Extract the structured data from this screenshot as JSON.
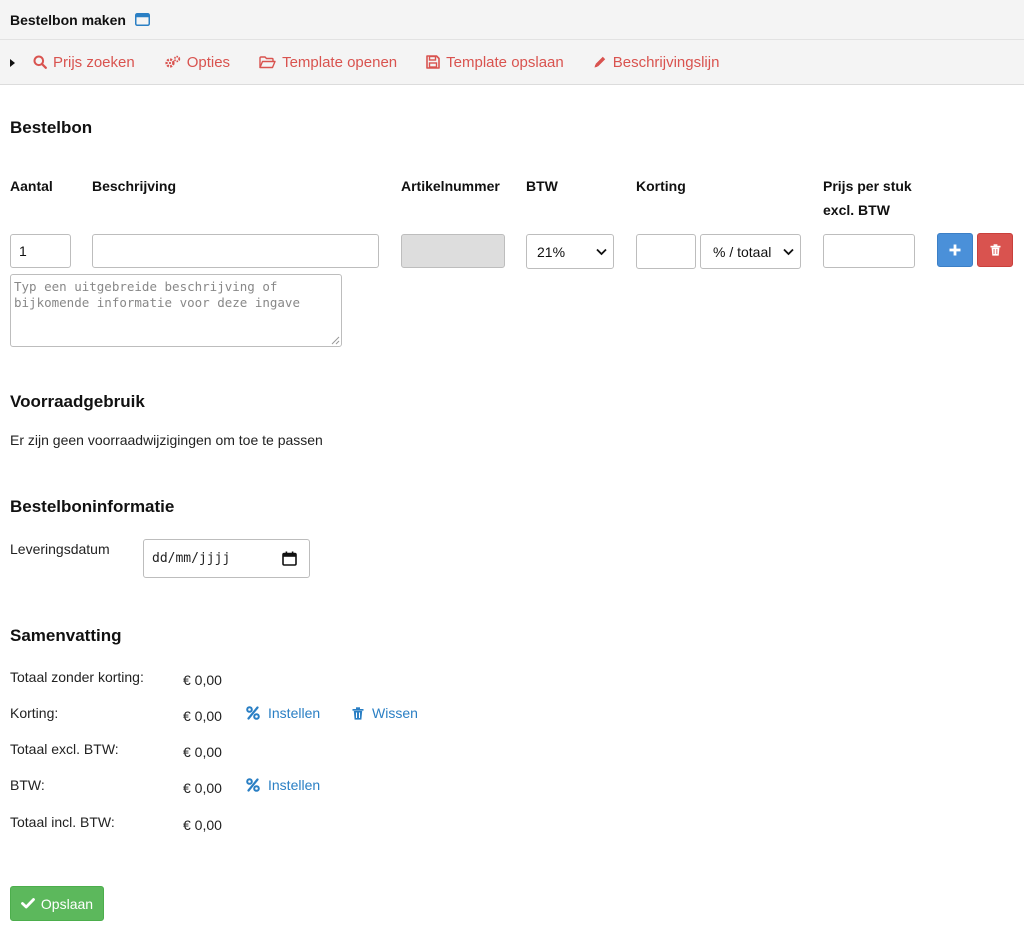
{
  "window": {
    "title": "Bestelbon maken",
    "icon": "window-icon"
  },
  "toolbar": {
    "items": [
      {
        "label": "Prijs zoeken",
        "icon": "search-icon"
      },
      {
        "label": "Opties",
        "icon": "cogs-icon"
      },
      {
        "label": "Template openen",
        "icon": "folder-open-icon"
      },
      {
        "label": "Template opslaan",
        "icon": "floppy-icon"
      },
      {
        "label": "Beschrijvingslijn",
        "icon": "pencil-icon"
      }
    ]
  },
  "bestelbon": {
    "heading": "Bestelbon",
    "columns": {
      "aantal": "Aantal",
      "beschrijving": "Beschrijving",
      "artikelnummer": "Artikelnummer",
      "btw": "BTW",
      "korting": "Korting",
      "prijs_line1": "Prijs per stuk",
      "prijs_line2": "excl. BTW"
    },
    "row": {
      "aantal": "1",
      "beschrijving": "",
      "artikelnummer": "",
      "btw": "21%",
      "korting_value": "",
      "korting_type": "% / totaal",
      "prijs": ""
    },
    "extra_placeholder": "Typ een uitgebreide beschrijving of\nbijkomende informatie voor deze ingave"
  },
  "voorraad": {
    "heading": "Voorraadgebruik",
    "message": "Er zijn geen voorraadwijzigingen om toe te passen"
  },
  "info": {
    "heading": "Bestelboninformatie",
    "levering_label": "Leveringsdatum",
    "levering_placeholder": "dd/mm/jjjj"
  },
  "samenvatting": {
    "heading": "Samenvatting",
    "rows": [
      {
        "label": "Totaal zonder korting:",
        "value": "€ 0,00"
      },
      {
        "label": "Korting:",
        "value": "€ 0,00"
      },
      {
        "label": "Totaal excl. BTW:",
        "value": "€ 0,00"
      },
      {
        "label": "BTW:",
        "value": "€ 0,00"
      },
      {
        "label": "Totaal incl. BTW:",
        "value": "€ 0,00"
      }
    ],
    "korting_instellen": "Instellen",
    "korting_wissen": "Wissen",
    "btw_instellen": "Instellen"
  },
  "save_label": "Opslaan",
  "colors": {
    "toolbar_link": "#d9534f",
    "link": "#2a7fc4",
    "primary": "#4a90d9",
    "danger": "#d9534f",
    "success": "#5cb85c"
  }
}
